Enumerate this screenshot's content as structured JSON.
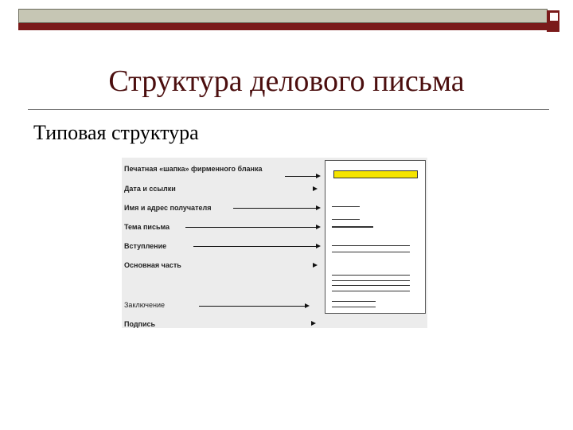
{
  "slide": {
    "title": "Структура делового письма",
    "subtitle": "Типовая структура"
  },
  "diagram": {
    "labels": [
      "Печатная «шапка» фирменного бланка",
      "Дата и ссылки",
      "Имя и адрес получателя",
      "Тема письма",
      "Вступление",
      "Основная часть",
      "Заключение",
      "Подпись"
    ],
    "colors": {
      "letterhead": "#f5e400",
      "accent": "#7a1a1a",
      "title": "#4b0e0e"
    }
  }
}
